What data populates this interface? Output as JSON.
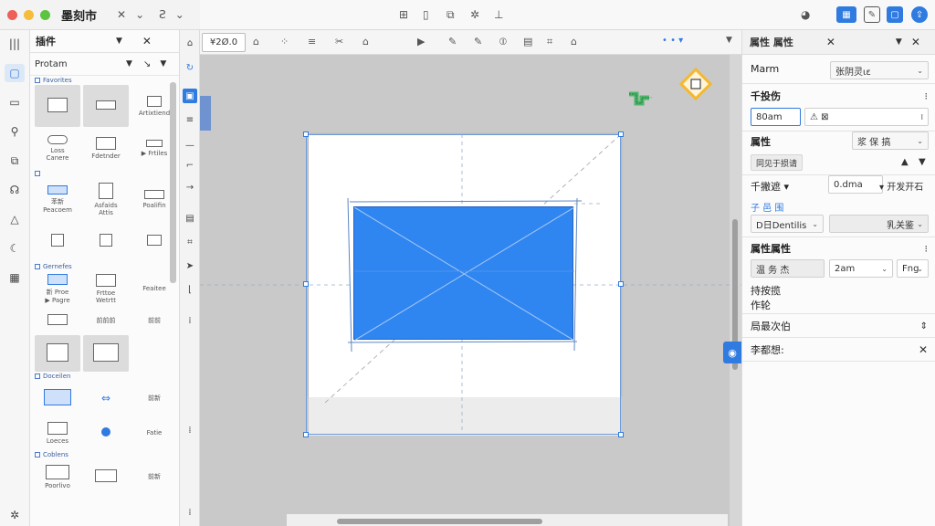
{
  "app": {
    "title": "墨刻市",
    "header_icons": [
      "sidebar-toggle-icon",
      "chevron-down-icon",
      "format-icon",
      "chevron-down-icon"
    ]
  },
  "left_rail": {
    "items": [
      {
        "name": "shapes",
        "icon": "▢",
        "active": true
      },
      {
        "name": "pages",
        "icon": "▭"
      },
      {
        "name": "links",
        "icon": "⚲"
      },
      {
        "name": "layers",
        "icon": "⧉"
      },
      {
        "name": "plugins",
        "icon": "☊"
      },
      {
        "name": "warnings",
        "icon": "△"
      },
      {
        "name": "comments",
        "icon": "☾"
      },
      {
        "name": "table",
        "icon": "▦"
      }
    ]
  },
  "shape_panel": {
    "tab_label": "插件",
    "search_value": "Protam",
    "sections": [
      {
        "title": "Favorites",
        "cells": [
          {
            "label": "",
            "sel": true,
            "style": ""
          },
          {
            "label": "",
            "sel": true,
            "style": ""
          },
          {
            "label": "Artixtiend",
            "style": ""
          },
          {
            "label": "Loss\nCanere",
            "style": "round"
          },
          {
            "label": "Fdetnder",
            "style": ""
          },
          {
            "label": "▶ Frtiles",
            "style": ""
          }
        ]
      },
      {
        "title": "",
        "cells": [
          {
            "label": "苯新\nPeacoem",
            "style": "blue"
          },
          {
            "label": "Asfaids\nAttis",
            "style": ""
          },
          {
            "label": "Poalifin",
            "style": ""
          },
          {
            "label": "",
            "style": ""
          },
          {
            "label": "",
            "style": ""
          },
          {
            "label": "",
            "style": ""
          }
        ]
      },
      {
        "title": "Gernefes",
        "cells": [
          {
            "label": "新 Proe\n▶ Pagre",
            "style": "blue"
          },
          {
            "label": "Frttoe\nWetrtt",
            "style": ""
          },
          {
            "label": "Feaitee",
            "style": ""
          },
          {
            "label": "",
            "style": ""
          },
          {
            "label": "前前前",
            "style": ""
          },
          {
            "label": "前前",
            "style": ""
          },
          {
            "label": "",
            "sel": true,
            "style": ""
          },
          {
            "label": "",
            "sel": true,
            "style": ""
          },
          {
            "label": "",
            "style": ""
          }
        ]
      },
      {
        "title": "Doceilen",
        "cells": [
          {
            "label": "",
            "style": "blue"
          },
          {
            "label": "",
            "style": "blue"
          },
          {
            "label": "前新",
            "style": ""
          },
          {
            "label": "Loeces",
            "style": ""
          },
          {
            "label": "",
            "style": "circle"
          },
          {
            "label": "Fatie",
            "style": ""
          }
        ]
      },
      {
        "title": "Coblens",
        "cells": [
          {
            "label": "Poorlivo",
            "style": ""
          },
          {
            "label": "",
            "style": ""
          },
          {
            "label": "前新",
            "style": ""
          }
        ]
      }
    ]
  },
  "top_toolbar": {
    "icons": [
      "align-icon",
      "page-icon",
      "copy-icon",
      "settings-icon",
      "ruler-icon"
    ],
    "right_icons": [
      "user-icon",
      "layout-icon",
      "edit-icon",
      "save-icon",
      "share-icon"
    ]
  },
  "secondary_toolbar": {
    "zoom": "¥2Ø.0",
    "icons": [
      "▶",
      "✎",
      "✎",
      "⦶",
      "▤",
      "⌗",
      "⌂"
    ],
    "dots": "• • ▾"
  },
  "canvas": {
    "colors": {
      "placeholder": "#2f86f0",
      "selection": "#2f7be0",
      "accent_yellow": "#f5b82e",
      "accent_green": "#4db56a"
    }
  },
  "right_panel": {
    "tab_title": "属性 属性",
    "rows": {
      "name_label": "Marm",
      "name_select": "张阴灵ιε",
      "size_label": "千投伤",
      "size_input": "80am",
      "size_unit": "⚠ ⊠",
      "size_suffix": "I",
      "property_label": "属性",
      "property_select": "浆 保 搞",
      "status_button": "同见于损请",
      "width_label": "千撇遮 ▾",
      "width_value": "0.dma",
      "width_suffix": "▾ 开发开石",
      "link_label": "子 邑 围",
      "link_select_left": "D日Dentilis",
      "link_select_right": "乳关鉴",
      "attr_label": "属性属性",
      "attr_select_left": "温 务 杰",
      "attr_select_right": "2am",
      "attr_select_extra": "Fng",
      "align_label": "持按揽",
      "align_sub": "作轮",
      "layout_label": "局最次伯",
      "more_label": "李都想:"
    }
  }
}
